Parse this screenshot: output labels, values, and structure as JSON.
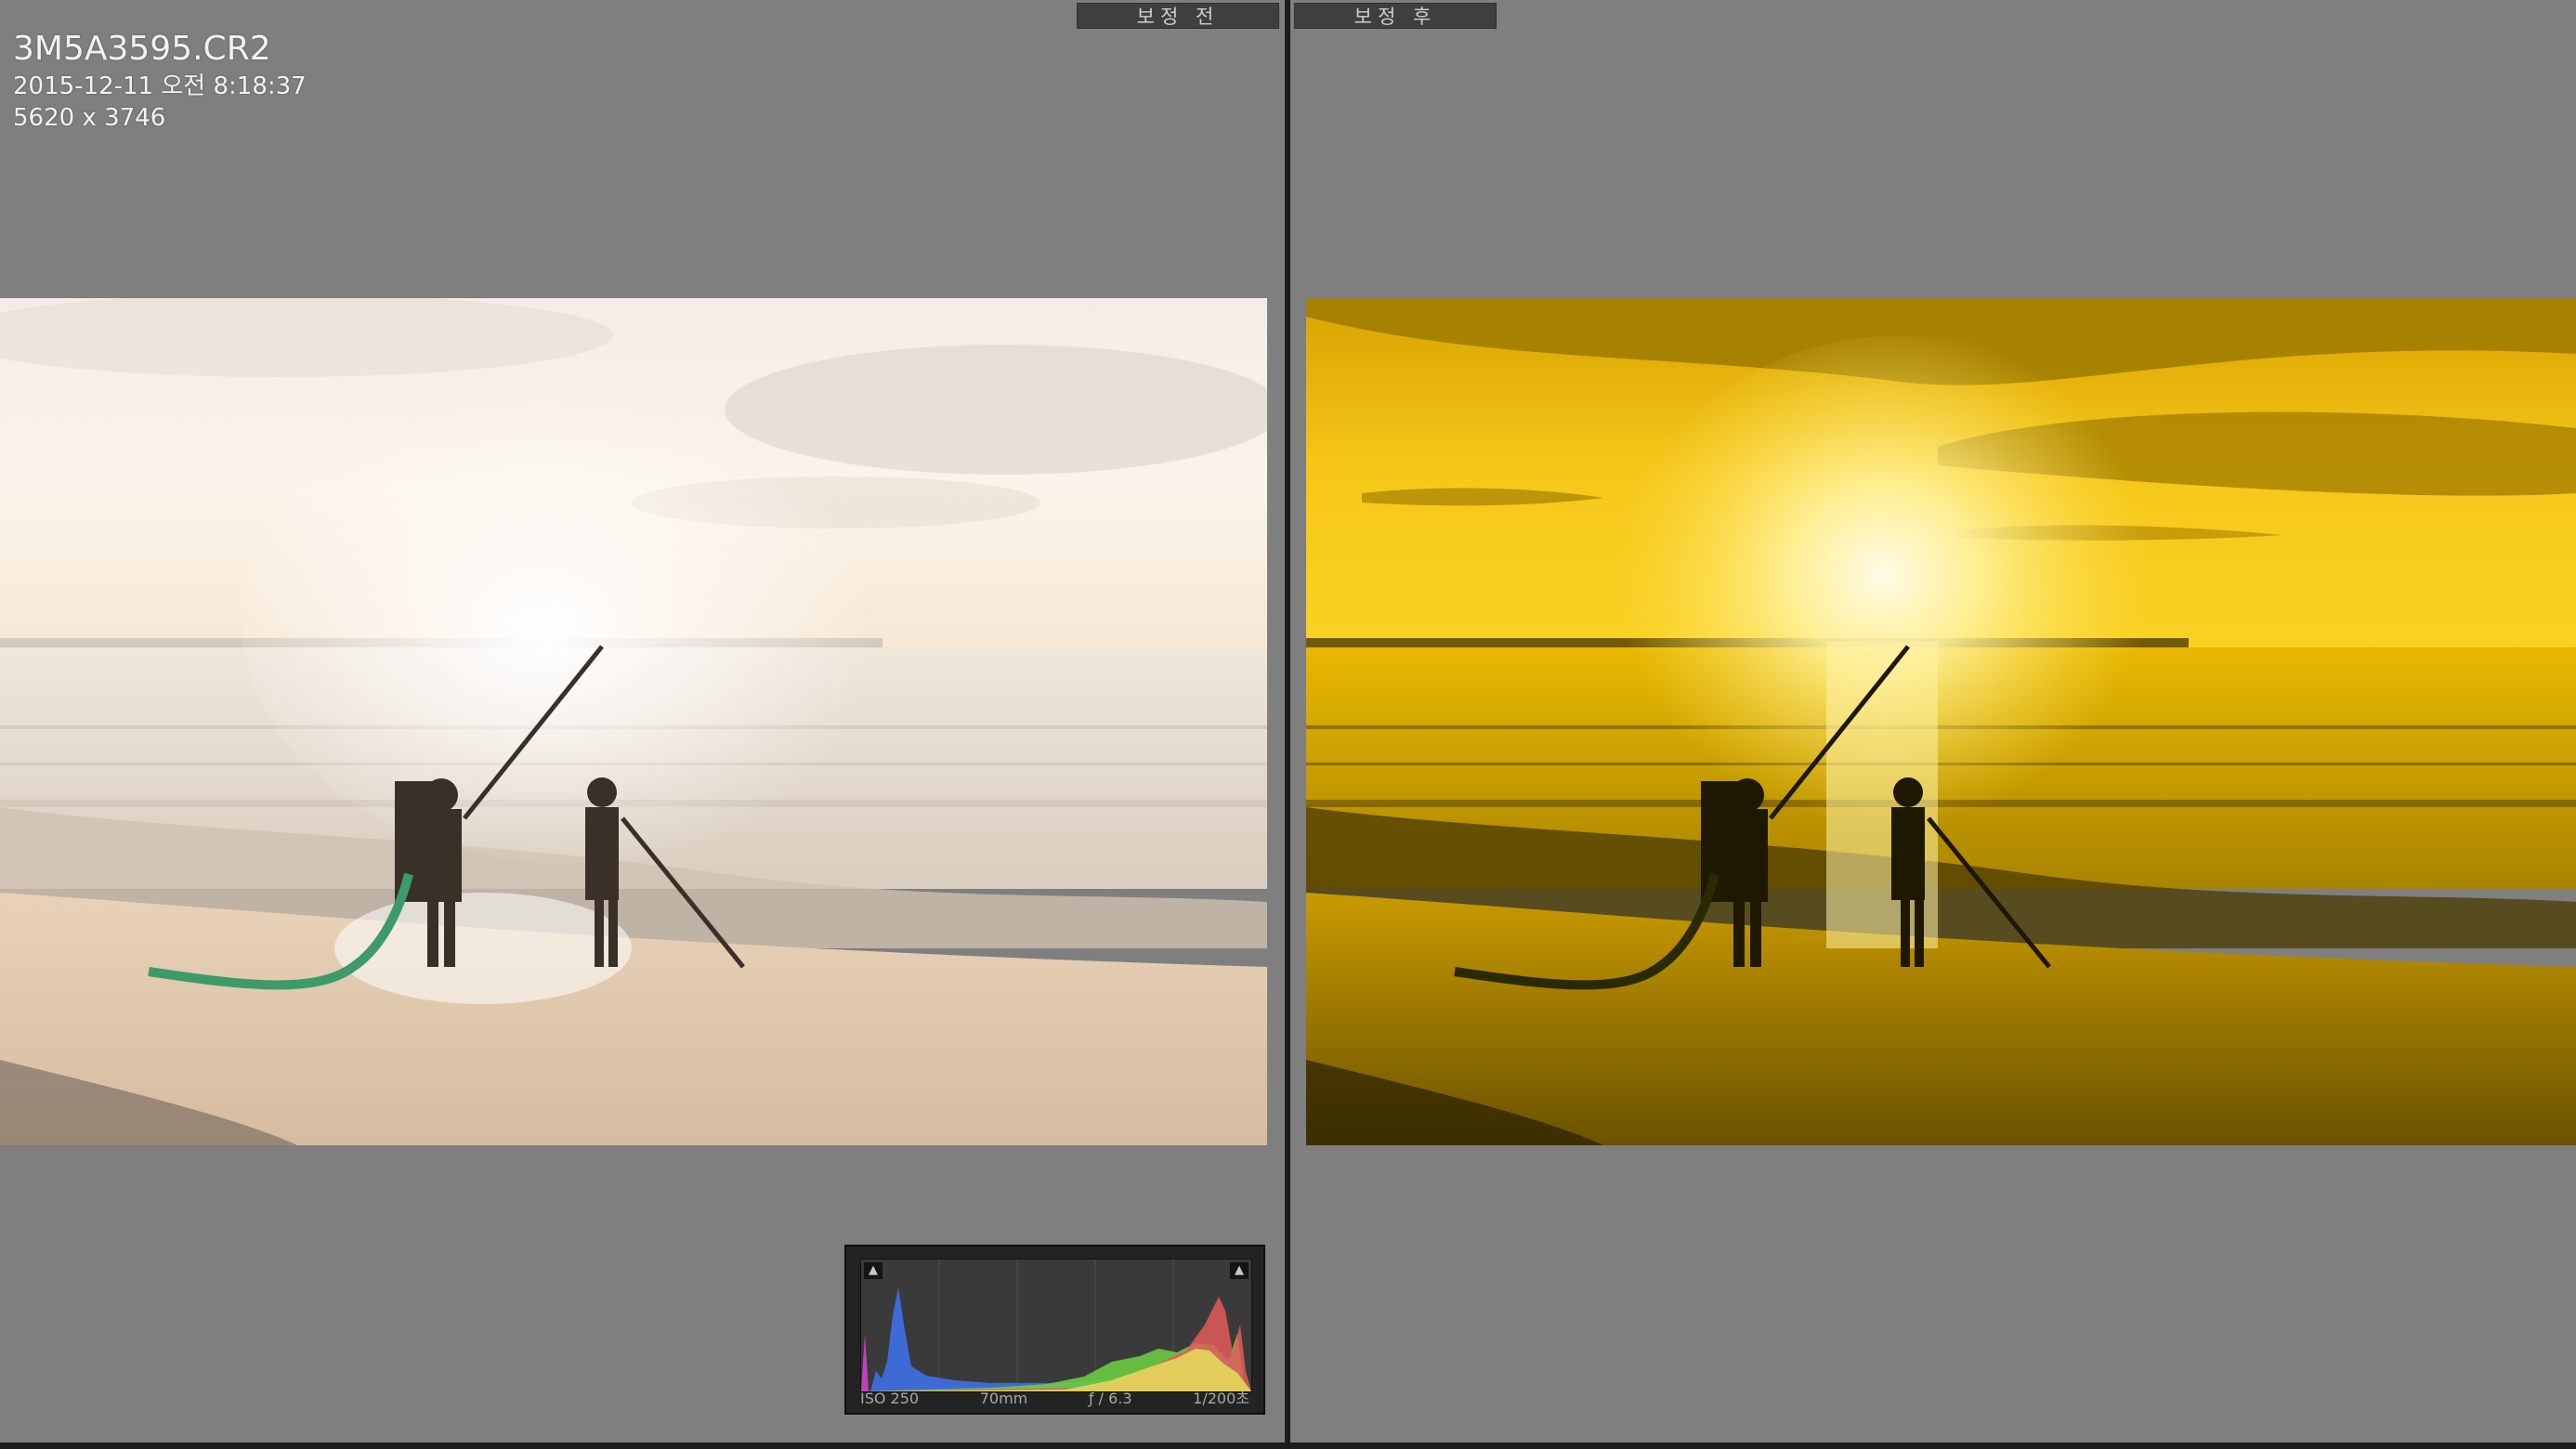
{
  "tabs": {
    "before": "보정 전",
    "after": "보정 후"
  },
  "photo_info": {
    "file_name": "3M5A3595.CR2",
    "capture_date": "2015-12-11 오전 8:18:37",
    "dimensions": "5620 x 3746"
  },
  "histogram": {
    "exif": {
      "iso": "ISO 250",
      "focal_length": "70mm",
      "aperture": "ƒ / 6.3",
      "shutter": "1/200초"
    },
    "shadow_clip_icon": "triangle-up",
    "highlight_clip_icon": "triangle-up"
  },
  "colors": {
    "background": "#7f7f7f",
    "divider": "#1c1c1c",
    "tab_bg": "#3f3f3f",
    "before_tone": "#f3e4d2",
    "after_tone": "#f1c30a"
  }
}
